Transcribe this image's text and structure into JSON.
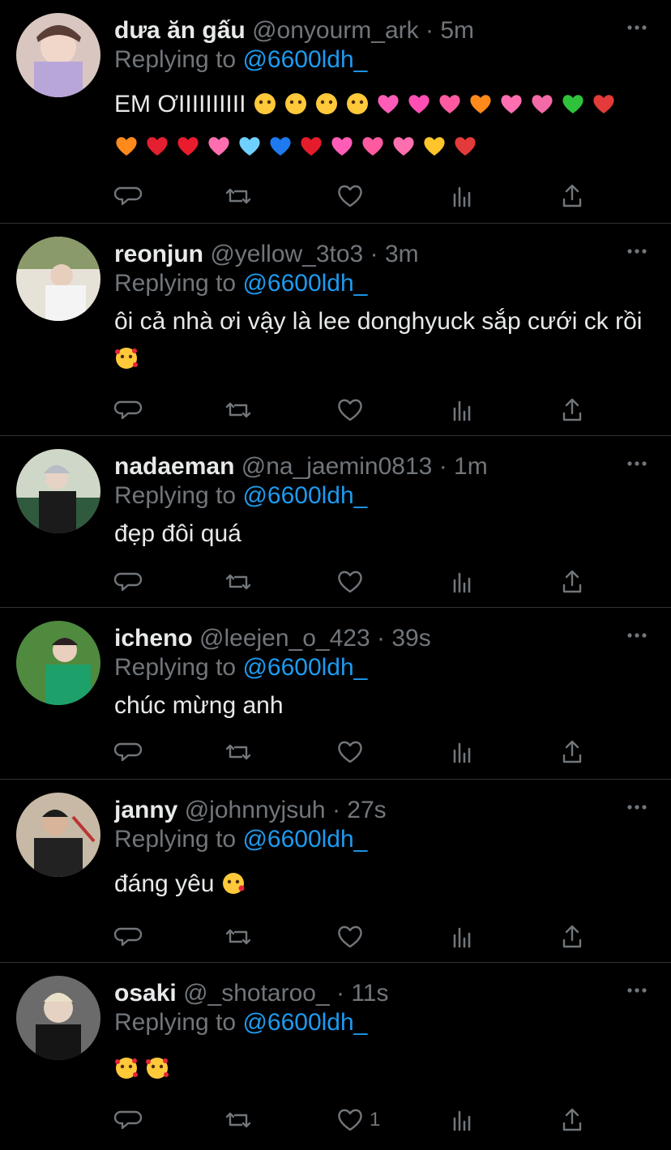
{
  "colors": {
    "background": "#000000",
    "text": "#e7e9ea",
    "muted": "#71767b",
    "link": "#1d9bf0",
    "divider": "#2f3336"
  },
  "replying_prefix": "Replying to",
  "replying_handle": "@6600ldh_",
  "tweets": [
    {
      "name": "dưa ăn gấu",
      "handle": "@onyourm_ark",
      "time": "5m",
      "text": "EM ƠIIIIIIIIII",
      "emoji_rows": [
        [
          "pleading",
          "pleading",
          "pleading",
          "pleading",
          "sparkle-heart",
          "pink-heart",
          "arrow-heart",
          "orange-heart",
          "two-hearts",
          "growing-heart",
          "green-heart",
          "mending-heart"
        ],
        [
          "orange-heart",
          "broken-heart",
          "red-heart",
          "two-hearts",
          "light-blue-heart",
          "blue-heart",
          "exclamation-heart",
          "sparkle-heart",
          "arrow-heart",
          "two-hearts",
          "yellow-heart",
          "mending-heart"
        ]
      ],
      "like_count": ""
    },
    {
      "name": "reonjun",
      "handle": "@yellow_3to3",
      "time": "3m",
      "text": "ôi cả nhà ơi vậy là lee donghyuck sắp cưới ck rồi",
      "emoji_end": [
        "smiling-hearts"
      ],
      "like_count": ""
    },
    {
      "name": "nadaeman",
      "handle": "@na_jaemin0813",
      "time": "1m",
      "text": "đẹp đôi quá",
      "like_count": ""
    },
    {
      "name": "icheno",
      "handle": "@leejen_o_423",
      "time": "39s",
      "text": "chúc mừng anh",
      "like_count": ""
    },
    {
      "name": "janny",
      "handle": "@johnnyjsuh",
      "time": "27s",
      "text": "đáng yêu",
      "emoji_end": [
        "kissing-heart"
      ],
      "like_count": ""
    },
    {
      "name": "osaki",
      "handle": "@_shotaroo_",
      "time": "11s",
      "text": "",
      "emoji_end": [
        "smiling-hearts",
        "smiling-hearts"
      ],
      "like_count": "1"
    }
  ],
  "icons": [
    "reply-icon",
    "retweet-icon",
    "like-icon",
    "analytics-icon",
    "share-icon",
    "more-icon"
  ]
}
